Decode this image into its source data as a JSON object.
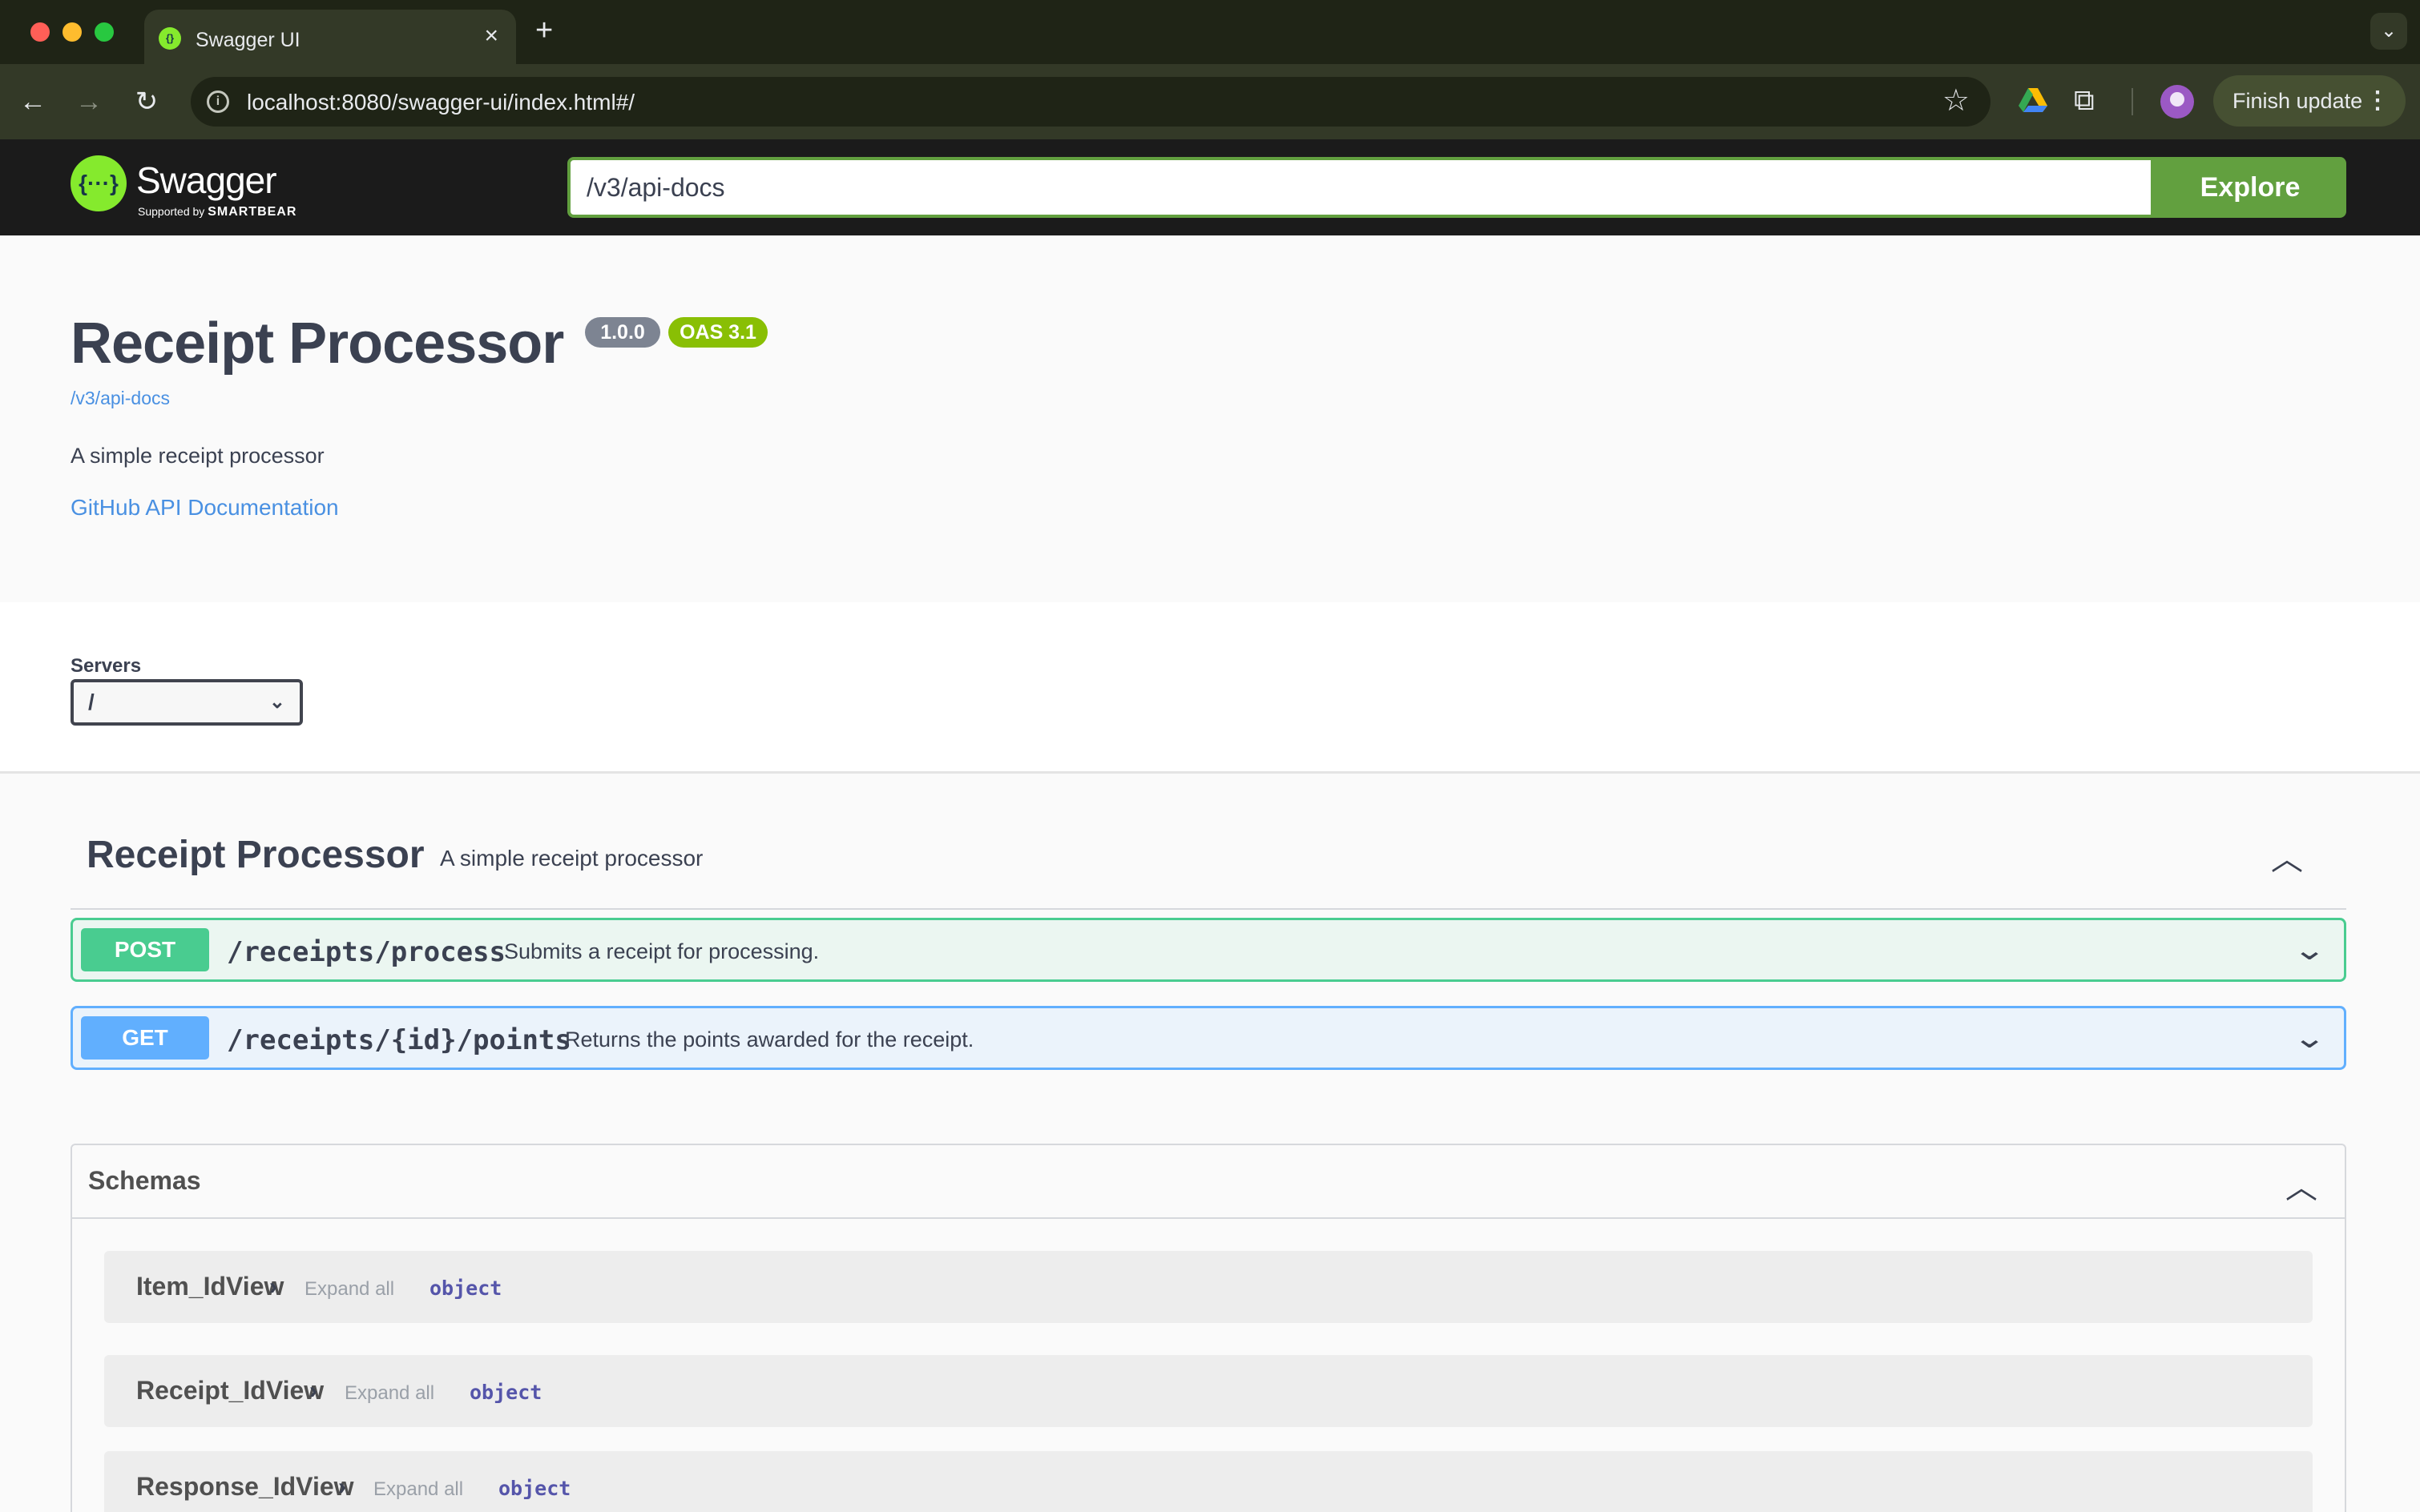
{
  "browser": {
    "tab_title": "Swagger UI",
    "tab_close": "×",
    "new_tab": "+",
    "url": "localhost:8080/swagger-ui/index.html#/",
    "finish_update": "Finish update",
    "icons": [
      "back-icon",
      "forward-icon",
      "reload-icon",
      "info-icon",
      "star-icon",
      "google-drive-icon",
      "extensions-icon",
      "profile-avatar",
      "more-vert-icon",
      "tab-search-icon"
    ]
  },
  "swagger": {
    "logo_text": "Swagger",
    "logo_sub_prefix": "Supported by",
    "logo_sub_brand": "SMARTBEAR",
    "spec_url": "/v3/api-docs",
    "explore_label": "Explore",
    "brand_color": "#85ea2d",
    "accent_color": "#62a03f"
  },
  "info": {
    "title": "Receipt Processor",
    "version": "1.0.0",
    "oas": "OAS 3.1",
    "url": "/v3/api-docs",
    "description": "A simple receipt processor",
    "link": "GitHub API Documentation"
  },
  "servers": {
    "label": "Servers",
    "selected": "/"
  },
  "tag": {
    "name": "Receipt Processor",
    "description": "A simple receipt processor"
  },
  "operations": [
    {
      "method": "POST",
      "path": "/receipts/process",
      "summary": "Submits a receipt for processing.",
      "color": "#49cc90"
    },
    {
      "method": "GET",
      "path": "/receipts/{id}/points",
      "summary": "Returns the points awarded for the receipt.",
      "color": "#61affe"
    }
  ],
  "schemas": {
    "title": "Schemas",
    "models": [
      {
        "name": "Item_IdView",
        "expand": "Expand all",
        "type": "object"
      },
      {
        "name": "Receipt_IdView",
        "expand": "Expand all",
        "type": "object"
      },
      {
        "name": "Response_IdView",
        "expand": "Expand all",
        "type": "object"
      }
    ]
  }
}
